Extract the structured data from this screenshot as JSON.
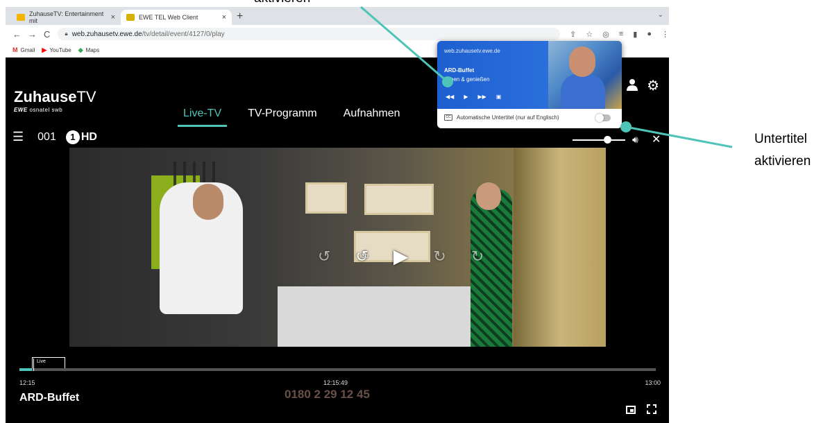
{
  "browser": {
    "tabs": [
      {
        "title": "ZuhauseTV: Entertainment mit",
        "close": "×",
        "favicon_color": "#f5b400"
      },
      {
        "title": "EWE TEL Web Client",
        "close": "×",
        "favicon_color": "#d8b000"
      }
    ],
    "new_tab": "+",
    "tab_menu": "⌄",
    "nav": {
      "back": "←",
      "forward": "→",
      "reload": "C"
    },
    "url_host": "web.zuhausetv.ewe.de",
    "url_path": "/tv/detail/event/4127/0/play",
    "bookmarks": [
      {
        "label": "Gmail",
        "icon": "gmail-icon",
        "glyph": "M",
        "color": "#d93025"
      },
      {
        "label": "YouTube",
        "icon": "youtube-icon",
        "glyph": "▶",
        "color": "#ff0000"
      },
      {
        "label": "Maps",
        "icon": "maps-icon",
        "glyph": "◆",
        "color": "#34a853"
      }
    ]
  },
  "app": {
    "logo_main_bold": "Zuhause",
    "logo_main_light": "TV",
    "logo_sub_bold": "EWE",
    "logo_sub_rest": " osnatel swb",
    "nav_tabs": [
      "Live-TV",
      "TV-Programm",
      "Aufnahmen"
    ],
    "active_tab": "Live-TV",
    "channel_number": "001",
    "channel_logo_one": "1",
    "channel_logo_hd": "HD",
    "volume_level": 0.66,
    "progress": {
      "live_label": "Live",
      "start_time": "12:15",
      "current_time": "12:15:49",
      "end_time": "13:00",
      "fraction": 0.02
    },
    "show_title": "ARD-Buffet",
    "overlay_phone": "0180 2 29 12 45",
    "accent_color": "#4ec3b7"
  },
  "media_popup": {
    "site": "web.zuhausetv.ewe.de",
    "title": "ARD-Buffet",
    "subtitle": "Leben & genießen",
    "controls": [
      "◀◀",
      "▶",
      "▶▶",
      "▣"
    ],
    "captions_label": "Automatische Untertitel (nur auf Englisch)",
    "captions_on": false
  },
  "annotations": {
    "top_label": "aktivieren",
    "right_label_line1": "Untertitel",
    "right_label_line2": "aktivieren",
    "arrow_color": "#4ec3b7"
  }
}
